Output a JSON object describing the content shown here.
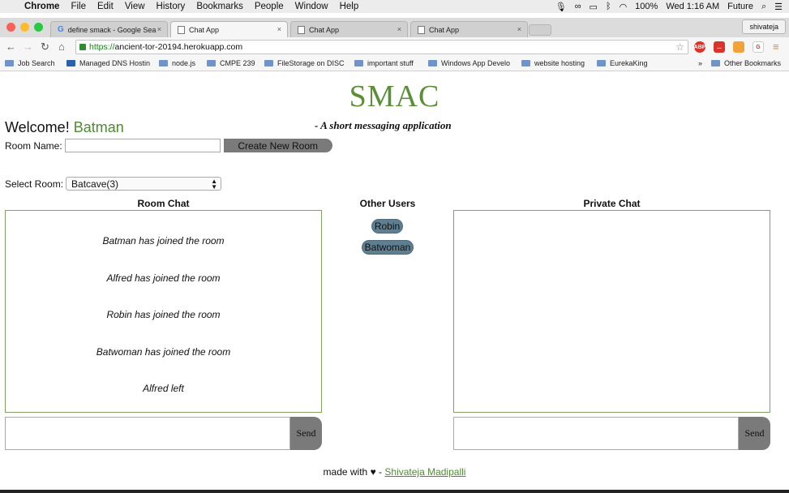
{
  "menubar": {
    "app": "Chrome",
    "items": [
      "File",
      "Edit",
      "View",
      "History",
      "Bookmarks",
      "People",
      "Window",
      "Help"
    ],
    "battery": "100%",
    "clock": "Wed 1:16 AM",
    "user": "Future"
  },
  "tabs": [
    {
      "label": "define smack - Google Sea",
      "icon": "google-icon"
    },
    {
      "label": "Chat App",
      "icon": "page-icon"
    },
    {
      "label": "Chat App",
      "icon": "page-icon"
    },
    {
      "label": "Chat App",
      "icon": "page-icon"
    }
  ],
  "profile": "shivateja",
  "address": {
    "scheme": "https://",
    "host": "ancient-tor-20194.herokuapp.com"
  },
  "extensions": [
    "ABP",
    "...",
    "",
    "G"
  ],
  "bookmarks": [
    "Job Search",
    "Managed DNS Hostin",
    "node.js",
    "CMPE 239",
    "FileStorage on DISC",
    "important stuff",
    "Windows App Develo",
    "website hosting",
    "EurekaKing"
  ],
  "bookmarks_overflow": "»",
  "other_bookmarks": "Other Bookmarks",
  "app": {
    "title": "SMAC",
    "tagline": "- A short messaging application",
    "welcome": "Welcome!",
    "username": "Batman",
    "room_name_label": "Room Name:",
    "room_name_value": "",
    "create_room_label": "Create New Room",
    "select_room_label": "Select Room:",
    "selected_room": "Batcave(3)",
    "room_chat_header": "Room Chat",
    "other_users_header": "Other Users",
    "private_chat_header": "Private Chat",
    "room_messages": [
      "Batman has joined the room",
      "Alfred has joined the room",
      "Robin has joined the room",
      "Batwoman has joined the room",
      "Alfred left"
    ],
    "other_users": [
      "Robin",
      "Batwoman"
    ],
    "send_label": "Send",
    "footer_prefix": "made with",
    "footer_heart": "♥",
    "footer_dash": "-",
    "footer_author": "Shivateja Madipalli"
  },
  "colors": {
    "brand_green": "#5a8f38",
    "pill": "#5f7f91",
    "button_gray": "#7a7a7a"
  }
}
